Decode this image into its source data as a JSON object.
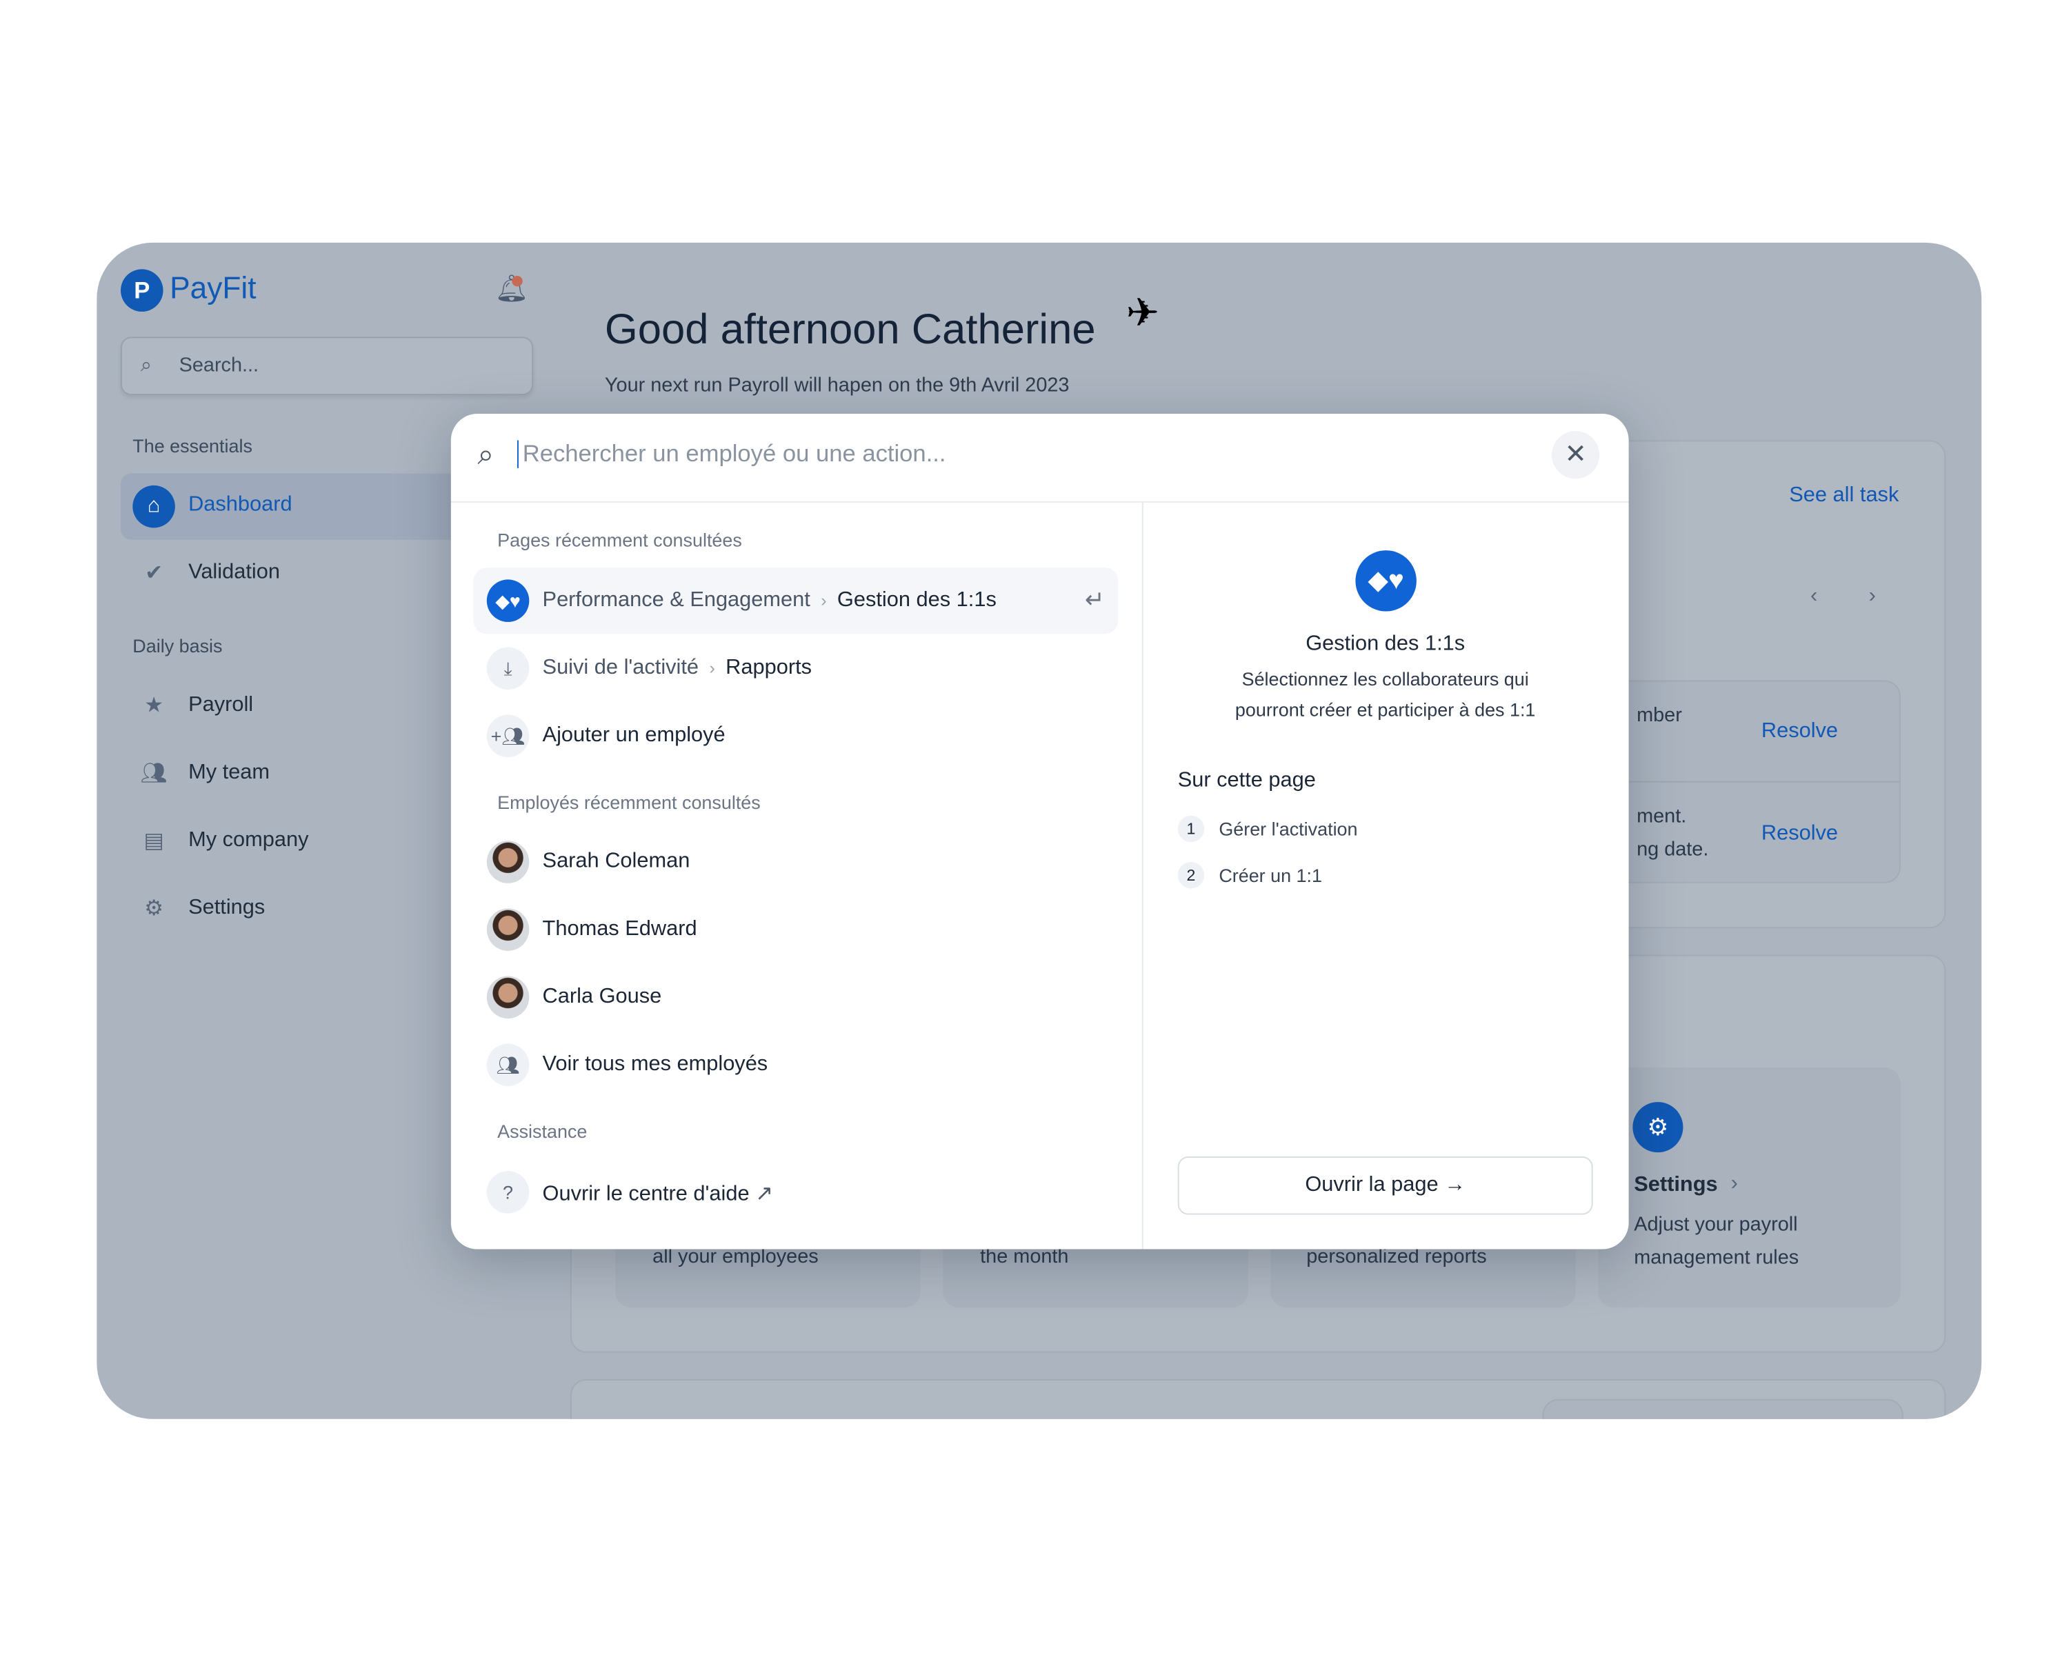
{
  "app": {
    "name": "PayFit",
    "brand_color": "#1059b5",
    "accent": "#1064d6"
  },
  "sidebar": {
    "search_placeholder": "Search...",
    "sections": [
      {
        "title": "The essentials"
      },
      {
        "title": "Daily basis"
      }
    ],
    "items": [
      {
        "label": "Dashboard",
        "icon": "home-icon",
        "active": true
      },
      {
        "label": "Validation",
        "icon": "badge-check-icon"
      },
      {
        "label": "Payroll",
        "icon": "payroll-icon"
      },
      {
        "label": "My team",
        "icon": "team-icon"
      },
      {
        "label": "My company",
        "icon": "store-icon"
      },
      {
        "label": "Settings",
        "icon": "gear-icon"
      }
    ]
  },
  "header": {
    "title": "Good afternoon Catherine",
    "subtitle": "Your next run Payroll will hapen on the 9th Avril 2023"
  },
  "tasks": {
    "see_all": "See all task",
    "rows": [
      {
        "text": "mber",
        "action": "Resolve"
      },
      {
        "text": "ment.",
        "text2": "ng date.",
        "action": "Resolve"
      }
    ]
  },
  "shortcuts": [
    {
      "desc": "all your employees"
    },
    {
      "desc": "the month"
    },
    {
      "desc": "personalized reports"
    },
    {
      "title": "Settings",
      "desc1": "Adjust your payroll",
      "desc2": "management rules"
    }
  ],
  "palette": {
    "search_placeholder": "Rechercher un employé ou une action...",
    "recent_pages_label": "Pages récemment consultées",
    "recent_pages": [
      {
        "parent": "Performance & Engagement",
        "page": "Gestion des 1:1s",
        "icon": "shapes-icon"
      },
      {
        "parent": "Suivi de l'activité",
        "page": "Rapports",
        "icon": "download-icon"
      },
      {
        "page": "Ajouter un employé",
        "icon": "add-user-icon"
      }
    ],
    "recent_employees_label": "Employés récemment consultés",
    "employees": [
      {
        "name": "Sarah Coleman"
      },
      {
        "name": "Thomas Edward"
      },
      {
        "name": "Carla Gouse"
      }
    ],
    "see_all_employees": "Voir tous mes employés",
    "assistance_label": "Assistance",
    "help_center": "Ouvrir le centre d'aide",
    "preview": {
      "title": "Gestion des 1:1s",
      "desc1": "Sélectionnez les collaborateurs qui",
      "desc2": "pourront créer et participer à des 1:1",
      "on_page_label": "Sur cette page",
      "sections": [
        {
          "n": "1",
          "label": "Gérer l'activation"
        },
        {
          "n": "2",
          "label": "Créer un 1:1"
        }
      ],
      "open_button": "Ouvrir la page"
    }
  }
}
